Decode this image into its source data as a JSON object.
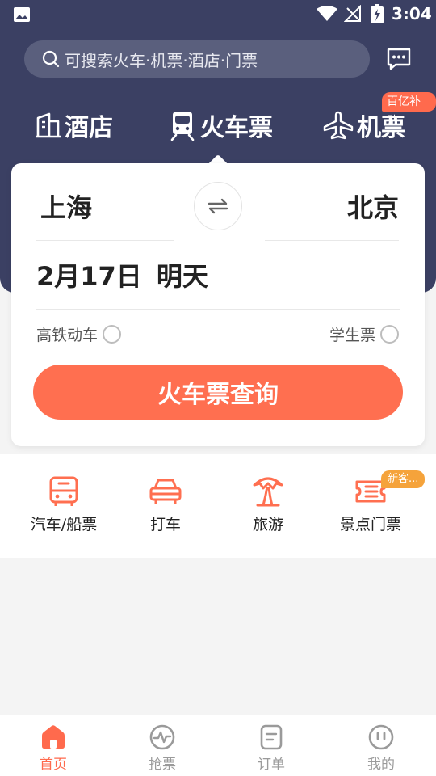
{
  "status_bar": {
    "time": "3:04"
  },
  "search": {
    "placeholder": "可搜索火车·机票·酒店·门票"
  },
  "categories": {
    "hotel": "酒店",
    "train": "火车票",
    "flight": "机票",
    "flight_badge": "百亿补贴"
  },
  "booking": {
    "from_city": "上海",
    "to_city": "北京",
    "date": "2月17日",
    "day_label": "明天",
    "high_speed_option": "高铁动车",
    "student_option": "学生票",
    "search_button": "火车票查询"
  },
  "services": {
    "bus_ship": "汽车/船票",
    "taxi": "打车",
    "travel": "旅游",
    "attractions": "景点门票",
    "attractions_badge": "新客..."
  },
  "bottom_nav": {
    "home": "首页",
    "grab": "抢票",
    "orders": "订单",
    "me": "我的"
  },
  "colors": {
    "header_bg": "#3b4063",
    "accent": "#ff6f50",
    "badge_orange": "#f5a33b"
  }
}
